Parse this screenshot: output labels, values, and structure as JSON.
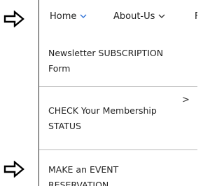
{
  "nav": {
    "home_label": "Home",
    "about_label": "About-Us",
    "cut_label": "F"
  },
  "menu": {
    "items": [
      {
        "label": "Newsletter SUBSCRIPTION Form"
      },
      {
        "label": "CHECK Your Membership STATUS",
        "submenu_glyph": ">"
      },
      {
        "label": "MAKE an EVENT RESERVATION"
      }
    ]
  },
  "icons": {
    "pointer": "outline-right-arrow-icon",
    "chevron": "chevron-down-icon"
  },
  "colors": {
    "accent_chevron": "#2b6fd6",
    "text": "#1f1f1f",
    "divider": "#b9b9b9"
  }
}
